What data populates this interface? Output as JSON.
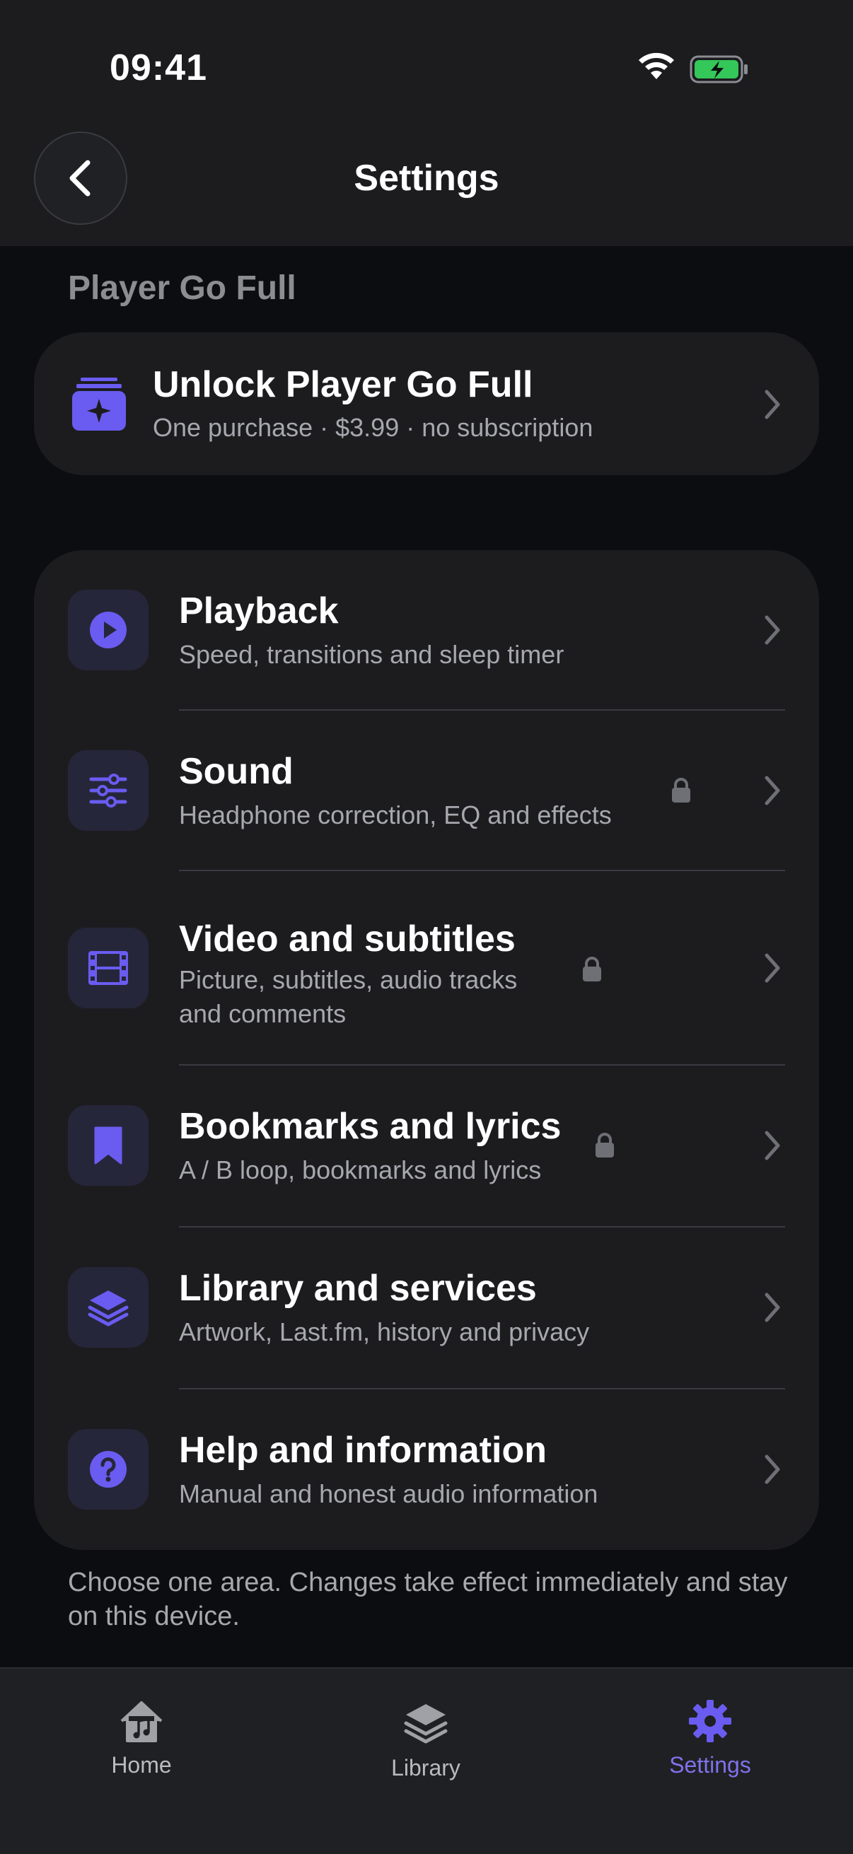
{
  "status_bar": {
    "time": "09:41"
  },
  "header": {
    "title": "Settings",
    "back_icon": "chevron-left-icon"
  },
  "section": {
    "label": "Player Go Full"
  },
  "unlock": {
    "title": "Unlock Player Go Full",
    "subtitle": "One purchase · $3.99 · no subscription",
    "icon": "stack-sparkle-icon"
  },
  "settings_rows": [
    {
      "title": "Playback",
      "subtitle": "Speed, transitions and sleep timer",
      "icon": "play-circle-icon",
      "locked": false
    },
    {
      "title": "Sound",
      "subtitle": "Headphone correction, EQ and effects",
      "icon": "sliders-icon",
      "locked": true
    },
    {
      "title": "Video and subtitles",
      "subtitle_line1": "Picture, subtitles, audio tracks",
      "subtitle_line2": "and comments",
      "icon": "film-icon",
      "locked": true
    },
    {
      "title": "Bookmarks and lyrics",
      "subtitle": "A / B loop, bookmarks and lyrics",
      "icon": "bookmark-icon",
      "locked": true
    },
    {
      "title": "Library and services",
      "subtitle": "Artwork, Last.fm, history and privacy",
      "icon": "layers-icon",
      "locked": false
    },
    {
      "title": "Help and information",
      "subtitle": "Manual and honest audio information",
      "icon": "help-circle-icon",
      "locked": false
    }
  ],
  "footnote": "Choose one area. Changes take effect immediately and stay on this device.",
  "tabs": [
    {
      "label": "Home",
      "icon": "home-music-icon",
      "active": false
    },
    {
      "label": "Library",
      "icon": "layers-icon",
      "active": false
    },
    {
      "label": "Settings",
      "icon": "gear-icon",
      "active": true
    }
  ],
  "colors": {
    "accent": "#6a5cf0",
    "background": "#0b0d10",
    "card": "#1c1c1f",
    "battery": "#34c759"
  }
}
